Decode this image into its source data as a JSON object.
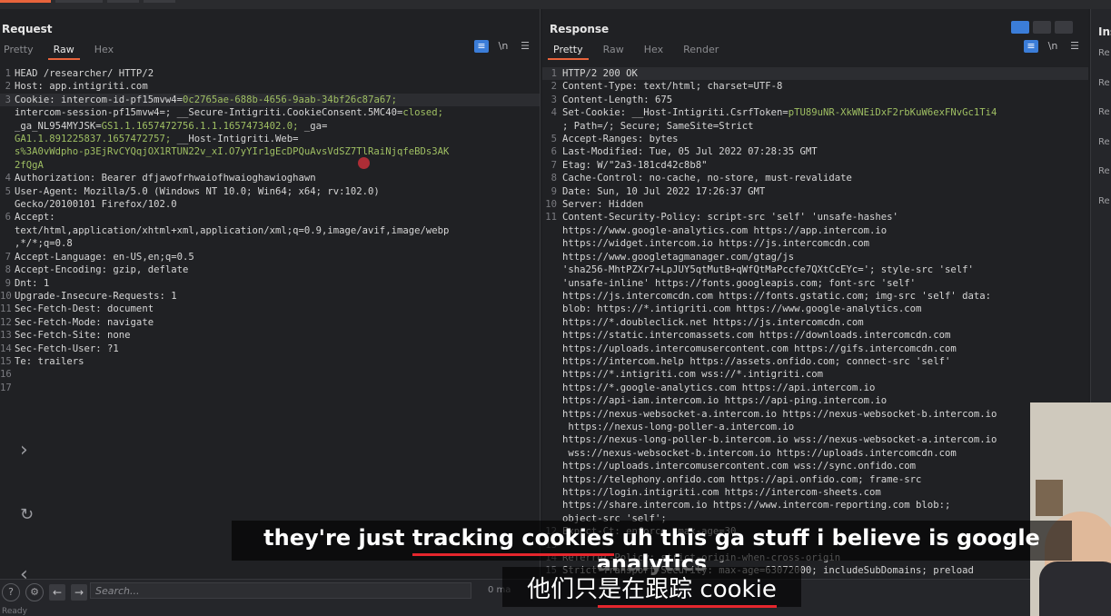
{
  "request": {
    "title": "Request",
    "tabs": [
      "Pretty",
      "Raw",
      "Hex"
    ],
    "active_tab": "Raw",
    "lines": [
      {
        "n": "1",
        "t": "HEAD /researcher/ HTTP/2"
      },
      {
        "n": "2",
        "t": "Host: app.intigriti.com"
      },
      {
        "n": "3",
        "a": "Cookie: intercom-id-pf15mvw4=",
        "g": "0c2765ae-688b-4656-9aab-34bf26c87a67;",
        "hl": true
      },
      {
        "n": "",
        "a": "intercom-session-pf15mvw4=; __Secure-Intigriti.CookieConsent.5MC40=",
        "g": "closed;"
      },
      {
        "n": "",
        "a": "_ga_NL954MYJSK=",
        "g": "GS1.1.1657472756.1.1.1657473402.0;",
        "b": " _ga="
      },
      {
        "n": "",
        "g": "GA1.1.891225837.1657472757;",
        "b": " __Host-Intigriti.Web="
      },
      {
        "n": "",
        "g": "s%3A0vWdpho-p3EjRvCYQqjOX1RTUN22v_xI.O7yYIr1gEcDPQuAvsVdSZ7TlRaiNjqfeBDs3AK"
      },
      {
        "n": "",
        "g": "2fQgA"
      },
      {
        "n": "4",
        "t": "Authorization: Bearer dfjawofrhwaiofhwaioghawioghawn"
      },
      {
        "n": "5",
        "t": "User-Agent: Mozilla/5.0 (Windows NT 10.0; Win64; x64; rv:102.0)"
      },
      {
        "n": "",
        "t": "Gecko/20100101 Firefox/102.0"
      },
      {
        "n": "6",
        "t": "Accept:"
      },
      {
        "n": "",
        "t": "text/html,application/xhtml+xml,application/xml;q=0.9,image/avif,image/webp"
      },
      {
        "n": "",
        "t": ",*/*;q=0.8"
      },
      {
        "n": "7",
        "t": "Accept-Language: en-US,en;q=0.5"
      },
      {
        "n": "8",
        "t": "Accept-Encoding: gzip, deflate"
      },
      {
        "n": "9",
        "t": "Dnt: 1"
      },
      {
        "n": "10",
        "t": "Upgrade-Insecure-Requests: 1"
      },
      {
        "n": "11",
        "t": "Sec-Fetch-Dest: document"
      },
      {
        "n": "12",
        "t": "Sec-Fetch-Mode: navigate"
      },
      {
        "n": "13",
        "t": "Sec-Fetch-Site: none"
      },
      {
        "n": "14",
        "t": "Sec-Fetch-User: ?1"
      },
      {
        "n": "15",
        "t": "Te: trailers"
      },
      {
        "n": "16",
        "t": ""
      },
      {
        "n": "17",
        "t": ""
      }
    ]
  },
  "response": {
    "title": "Response",
    "tabs": [
      "Pretty",
      "Raw",
      "Hex",
      "Render"
    ],
    "active_tab": "Pretty",
    "lines": [
      {
        "n": "1",
        "t": "HTTP/2 200 OK",
        "hl": true
      },
      {
        "n": "2",
        "t": "Content-Type: text/html; charset=UTF-8"
      },
      {
        "n": "3",
        "t": "Content-Length: 675"
      },
      {
        "n": "4",
        "a": "Set-Cookie: __Host-Intigriti.CsrfToken=",
        "g": "pTU89uNR-XkWNEiDxF2rbKuW6exFNvGc1Ti4"
      },
      {
        "n": "",
        "t": "; Path=/; Secure; SameSite=Strict"
      },
      {
        "n": "5",
        "t": "Accept-Ranges: bytes"
      },
      {
        "n": "6",
        "t": "Last-Modified: Tue, 05 Jul 2022 07:28:35 GMT"
      },
      {
        "n": "7",
        "t": "Etag: W/\"2a3-181cd42c8b8\""
      },
      {
        "n": "8",
        "t": "Cache-Control: no-cache, no-store, must-revalidate"
      },
      {
        "n": "9",
        "t": "Date: Sun, 10 Jul 2022 17:26:37 GMT"
      },
      {
        "n": "10",
        "t": "Server: Hidden"
      },
      {
        "n": "11",
        "t": "Content-Security-Policy: script-src 'self' 'unsafe-hashes'"
      },
      {
        "n": "",
        "t": "https://www.google-analytics.com https://app.intercom.io"
      },
      {
        "n": "",
        "t": "https://widget.intercom.io https://js.intercomcdn.com"
      },
      {
        "n": "",
        "t": "https://www.googletagmanager.com/gtag/js"
      },
      {
        "n": "",
        "t": "'sha256-MhtPZXr7+LpJUY5qtMutB+qWfQtMaPccfe7QXtCcEYc='; style-src 'self'"
      },
      {
        "n": "",
        "t": "'unsafe-inline' https://fonts.googleapis.com; font-src 'self'"
      },
      {
        "n": "",
        "t": "https://js.intercomcdn.com https://fonts.gstatic.com; img-src 'self' data:"
      },
      {
        "n": "",
        "t": "blob: https://*.intigriti.com https://www.google-analytics.com"
      },
      {
        "n": "",
        "t": "https://*.doubleclick.net https://js.intercomcdn.com"
      },
      {
        "n": "",
        "t": "https://static.intercomassets.com https://downloads.intercomcdn.com"
      },
      {
        "n": "",
        "t": "https://uploads.intercomusercontent.com https://gifs.intercomcdn.com"
      },
      {
        "n": "",
        "t": "https://intercom.help https://assets.onfido.com; connect-src 'self'"
      },
      {
        "n": "",
        "t": "https://*.intigriti.com wss://*.intigriti.com"
      },
      {
        "n": "",
        "t": "https://*.google-analytics.com https://api.intercom.io"
      },
      {
        "n": "",
        "t": "https://api-iam.intercom.io https://api-ping.intercom.io"
      },
      {
        "n": "",
        "t": "https://nexus-websocket-a.intercom.io https://nexus-websocket-b.intercom.io"
      },
      {
        "n": "",
        "t": " https://nexus-long-poller-a.intercom.io"
      },
      {
        "n": "",
        "t": "https://nexus-long-poller-b.intercom.io wss://nexus-websocket-a.intercom.io"
      },
      {
        "n": "",
        "t": " wss://nexus-websocket-b.intercom.io https://uploads.intercomcdn.com"
      },
      {
        "n": "",
        "t": "https://uploads.intercomusercontent.com wss://sync.onfido.com"
      },
      {
        "n": "",
        "t": "https://telephony.onfido.com https://api.onfido.com; frame-src"
      },
      {
        "n": "",
        "t": "https://login.intigriti.com https://intercom-sheets.com"
      },
      {
        "n": "",
        "t": "https://share.intercom.io https://www.intercom-reporting.com blob:;"
      },
      {
        "n": "",
        "t": "object-src 'self';"
      },
      {
        "n": "12",
        "t": "Expect-Ct: enforce, max-age=30"
      },
      {
        "n": "13",
        "t": ""
      },
      {
        "n": "14",
        "t": "Referrer-Policy: strict-origin-when-cross-origin"
      },
      {
        "n": "15",
        "t": "Strict-Transport-Security: max-age=63072000; includeSubDomains; preload"
      }
    ]
  },
  "inspector": {
    "title": "Ins",
    "items": [
      "Re",
      "Re",
      "Re",
      "Re",
      "Re",
      "Re"
    ]
  },
  "bottom_bar": {
    "search_placeholder": "Search...",
    "matches": "0 ma",
    "status": "Ready"
  },
  "subtitles": {
    "en_before": "they're just ",
    "en_underlined": "tracking cookies",
    "en_after": " uh this ga stuff i believe is google analytics",
    "zh_before": "他们只",
    "zh_underlined": "是在跟踪 cookie"
  },
  "colors": {
    "accent": "#e8643c",
    "selected_blue": "#3b7dd8",
    "value_green": "#9fbf63",
    "subtitle_underline": "#e5262d"
  }
}
